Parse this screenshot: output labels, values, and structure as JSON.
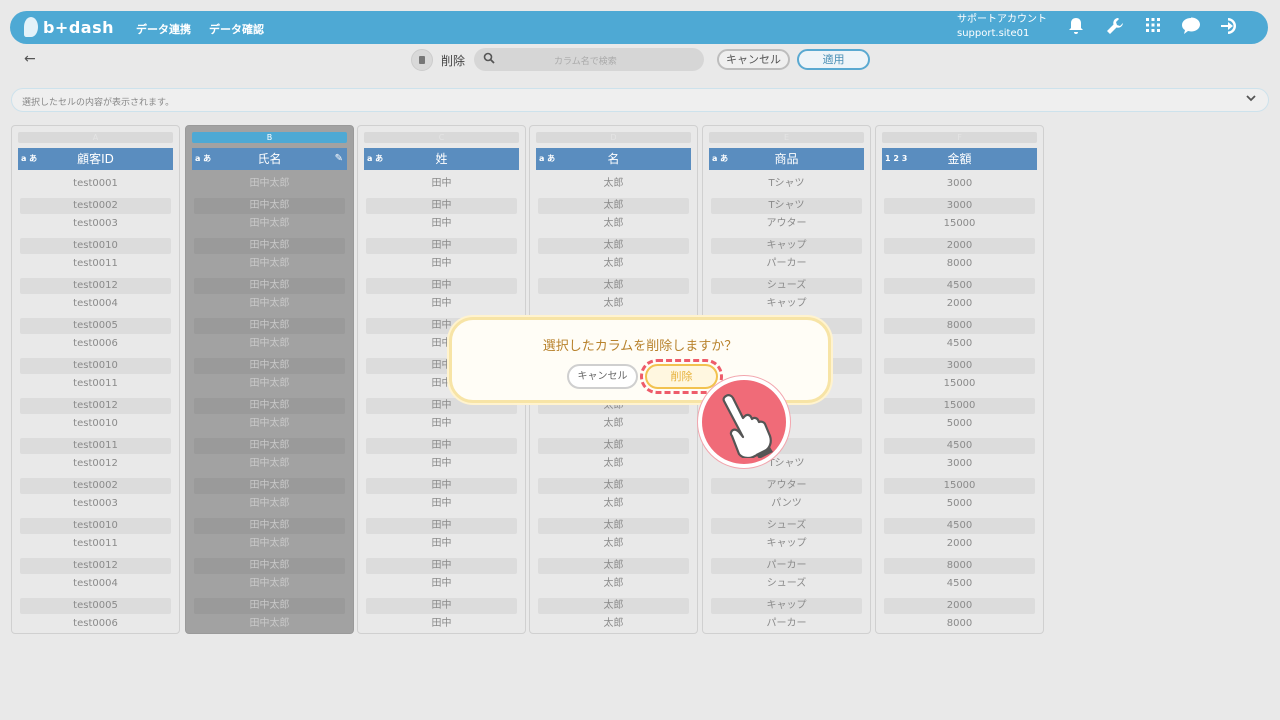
{
  "header": {
    "logo_text": "b+dash",
    "nav": [
      "データ連携",
      "データ確認"
    ],
    "account_name": "サポートアカウント",
    "account_id": "support.site01",
    "icons": [
      "bell-icon",
      "wrench-icon",
      "grid-icon",
      "chat-icon",
      "logout-icon"
    ]
  },
  "toolbar": {
    "back_icon": "←",
    "delete_label": "削除",
    "search_placeholder": "カラム名で検索",
    "cancel_label": "キャンセル",
    "apply_label": "適用"
  },
  "cellbar": {
    "text": "選択したセルの内容が表示されます。"
  },
  "columns": [
    {
      "letter": "A",
      "type": "a あ",
      "name": "顧客ID",
      "selected": false,
      "values": [
        "test0001",
        "test0002",
        "test0003",
        "test0010",
        "test0011",
        "test0012",
        "test0004",
        "test0005",
        "test0006",
        "test0010",
        "test0011",
        "test0012",
        "test0010",
        "test0011",
        "test0012",
        "test0002",
        "test0003",
        "test0010",
        "test0011",
        "test0012",
        "test0004",
        "test0005",
        "test0006"
      ]
    },
    {
      "letter": "B",
      "type": "a あ",
      "name": "氏名",
      "selected": true,
      "values": [
        "田中太郎",
        "田中太郎",
        "田中太郎",
        "田中太郎",
        "田中太郎",
        "田中太郎",
        "田中太郎",
        "田中太郎",
        "田中太郎",
        "田中太郎",
        "田中太郎",
        "田中太郎",
        "田中太郎",
        "田中太郎",
        "田中太郎",
        "田中太郎",
        "田中太郎",
        "田中太郎",
        "田中太郎",
        "田中太郎",
        "田中太郎",
        "田中太郎",
        "田中太郎"
      ]
    },
    {
      "letter": "C",
      "type": "a あ",
      "name": "姓",
      "selected": false,
      "values": [
        "田中",
        "田中",
        "田中",
        "田中",
        "田中",
        "田中",
        "田中",
        "田中",
        "田中",
        "田中",
        "田中",
        "田中",
        "田中",
        "田中",
        "田中",
        "田中",
        "田中",
        "田中",
        "田中",
        "田中",
        "田中",
        "田中",
        "田中"
      ]
    },
    {
      "letter": "D",
      "type": "a あ",
      "name": "名",
      "selected": false,
      "values": [
        "太郎",
        "太郎",
        "太郎",
        "太郎",
        "太郎",
        "太郎",
        "太郎",
        "太郎",
        "太郎",
        "太郎",
        "太郎",
        "太郎",
        "太郎",
        "太郎",
        "太郎",
        "太郎",
        "太郎",
        "太郎",
        "太郎",
        "太郎",
        "太郎",
        "太郎",
        "太郎"
      ]
    },
    {
      "letter": "E",
      "type": "a あ",
      "name": "商品",
      "selected": false,
      "values": [
        "Tシャツ",
        "Tシャツ",
        "アウター",
        "キャップ",
        "パーカー",
        "シューズ",
        "キャップ",
        "",
        "",
        "",
        "",
        "",
        "",
        "",
        "Tシャツ",
        "アウター",
        "パンツ",
        "シューズ",
        "キャップ",
        "パーカー",
        "シューズ",
        "キャップ",
        "パーカー"
      ]
    },
    {
      "letter": "F",
      "type": "1 2 3",
      "name": "金額",
      "selected": false,
      "values": [
        "3000",
        "3000",
        "15000",
        "2000",
        "8000",
        "4500",
        "2000",
        "8000",
        "4500",
        "3000",
        "15000",
        "15000",
        "5000",
        "4500",
        "3000",
        "15000",
        "5000",
        "4500",
        "2000",
        "8000",
        "4500",
        "2000",
        "8000"
      ]
    }
  ],
  "dialog": {
    "message": "選択したカラムを削除しますか？",
    "cancel_label": "キャンセル",
    "delete_label": "削除"
  },
  "colors": {
    "header": "#4ea9d4",
    "column_header": "#5a8dbf",
    "dialog_border": "#f7e4a6",
    "highlight": "#ee5c6a"
  }
}
